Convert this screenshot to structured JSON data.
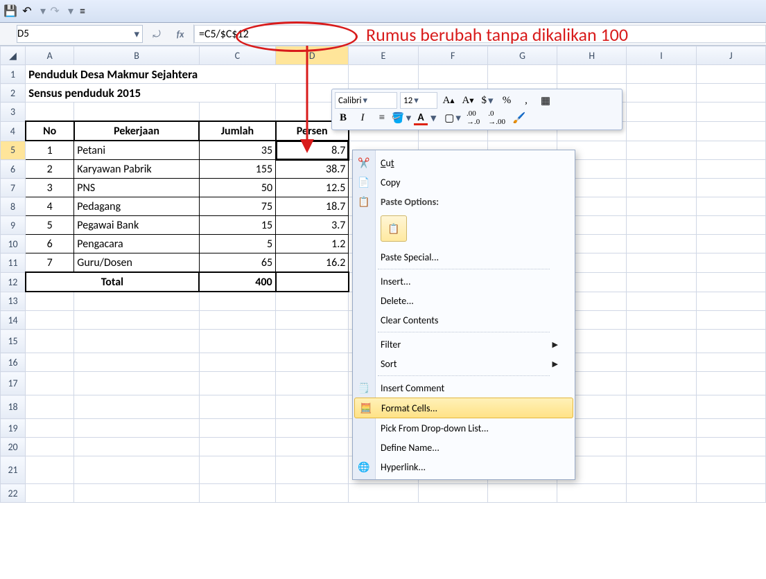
{
  "name_box": "D5",
  "formula": "=C5/$C$12",
  "annotation_text": "Rumus berubah tanpa dikalikan 100",
  "columns": [
    "A",
    "B",
    "C",
    "D",
    "E",
    "F",
    "G",
    "H",
    "I",
    "J"
  ],
  "row_numbers": [
    "1",
    "2",
    "3",
    "4",
    "5",
    "6",
    "7",
    "8",
    "9",
    "10",
    "11",
    "12",
    "13",
    "14",
    "15",
    "16",
    "17",
    "18",
    "19",
    "20",
    "21",
    "22"
  ],
  "title1": "Penduduk Desa Makmur Sejahtera",
  "title2": "Sensus penduduk 2015",
  "headers": {
    "no": "No",
    "job": "Pekerjaan",
    "count": "Jumlah",
    "percent": "Persen"
  },
  "rows": [
    {
      "no": "1",
      "job": "Petani",
      "count": "35",
      "pct": "8.7"
    },
    {
      "no": "2",
      "job": "Karyawan Pabrik",
      "count": "155",
      "pct": "38.7"
    },
    {
      "no": "3",
      "job": "PNS",
      "count": "50",
      "pct": "12.5"
    },
    {
      "no": "4",
      "job": "Pedagang",
      "count": "75",
      "pct": "18.7"
    },
    {
      "no": "5",
      "job": "Pegawai Bank",
      "count": "15",
      "pct": "3.7"
    },
    {
      "no": "6",
      "job": "Pengacara",
      "count": "5",
      "pct": "1.2"
    },
    {
      "no": "7",
      "job": "Guru/Dosen",
      "count": "65",
      "pct": "16.2"
    }
  ],
  "total_label": "Total",
  "total_value": "400",
  "mini_toolbar": {
    "font": "Calibri",
    "size": "12"
  },
  "context_menu": {
    "cut": "Cut",
    "copy": "Copy",
    "paste_options": "Paste Options:",
    "paste_special": "Paste Special...",
    "insert": "Insert...",
    "delete": "Delete...",
    "clear": "Clear Contents",
    "filter": "Filter",
    "sort": "Sort",
    "insert_comment": "Insert Comment",
    "format_cells": "Format Cells...",
    "pick_list": "Pick From Drop-down List...",
    "define_name": "Define Name...",
    "hyperlink": "Hyperlink..."
  }
}
